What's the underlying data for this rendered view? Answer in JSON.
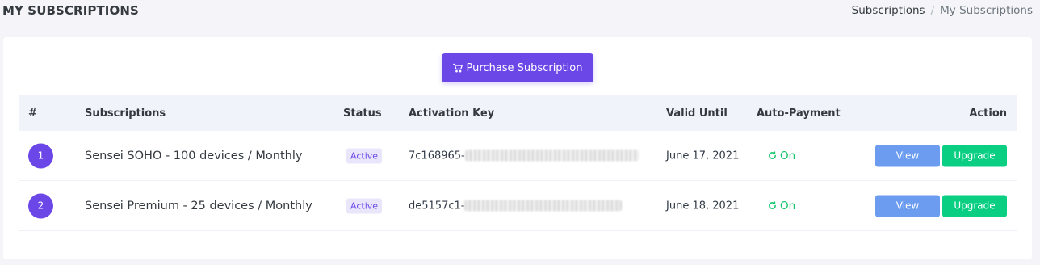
{
  "header": {
    "title": "MY SUBSCRIPTIONS",
    "breadcrumb": [
      "Subscriptions",
      "My Subscriptions"
    ],
    "breadcrumb_separator": "/"
  },
  "purchase_button": {
    "label": "Purchase Subscription",
    "icon": "cart-icon",
    "color": "#6c47e8"
  },
  "table": {
    "columns": [
      "#",
      "Subscriptions",
      "Status",
      "Activation Key",
      "Valid Until",
      "Auto-Payment",
      "Action"
    ],
    "rows": [
      {
        "num": "1",
        "name": "Sensei SOHO - 100 devices / Monthly",
        "status": "Active",
        "key_prefix": "7c168965-",
        "valid_until": "June 17, 2021",
        "auto_payment": "On",
        "view_label": "View",
        "upgrade_label": "Upgrade"
      },
      {
        "num": "2",
        "name": "Sensei Premium - 25 devices / Monthly",
        "status": "Active",
        "key_prefix": "de5157c1-",
        "valid_until": "June 18, 2021",
        "auto_payment": "On",
        "view_label": "View",
        "upgrade_label": "Upgrade"
      }
    ]
  },
  "colors": {
    "primary": "#6c47e8",
    "success": "#10c469",
    "info": "#6c9cf0",
    "upgrade": "#0acf83"
  }
}
